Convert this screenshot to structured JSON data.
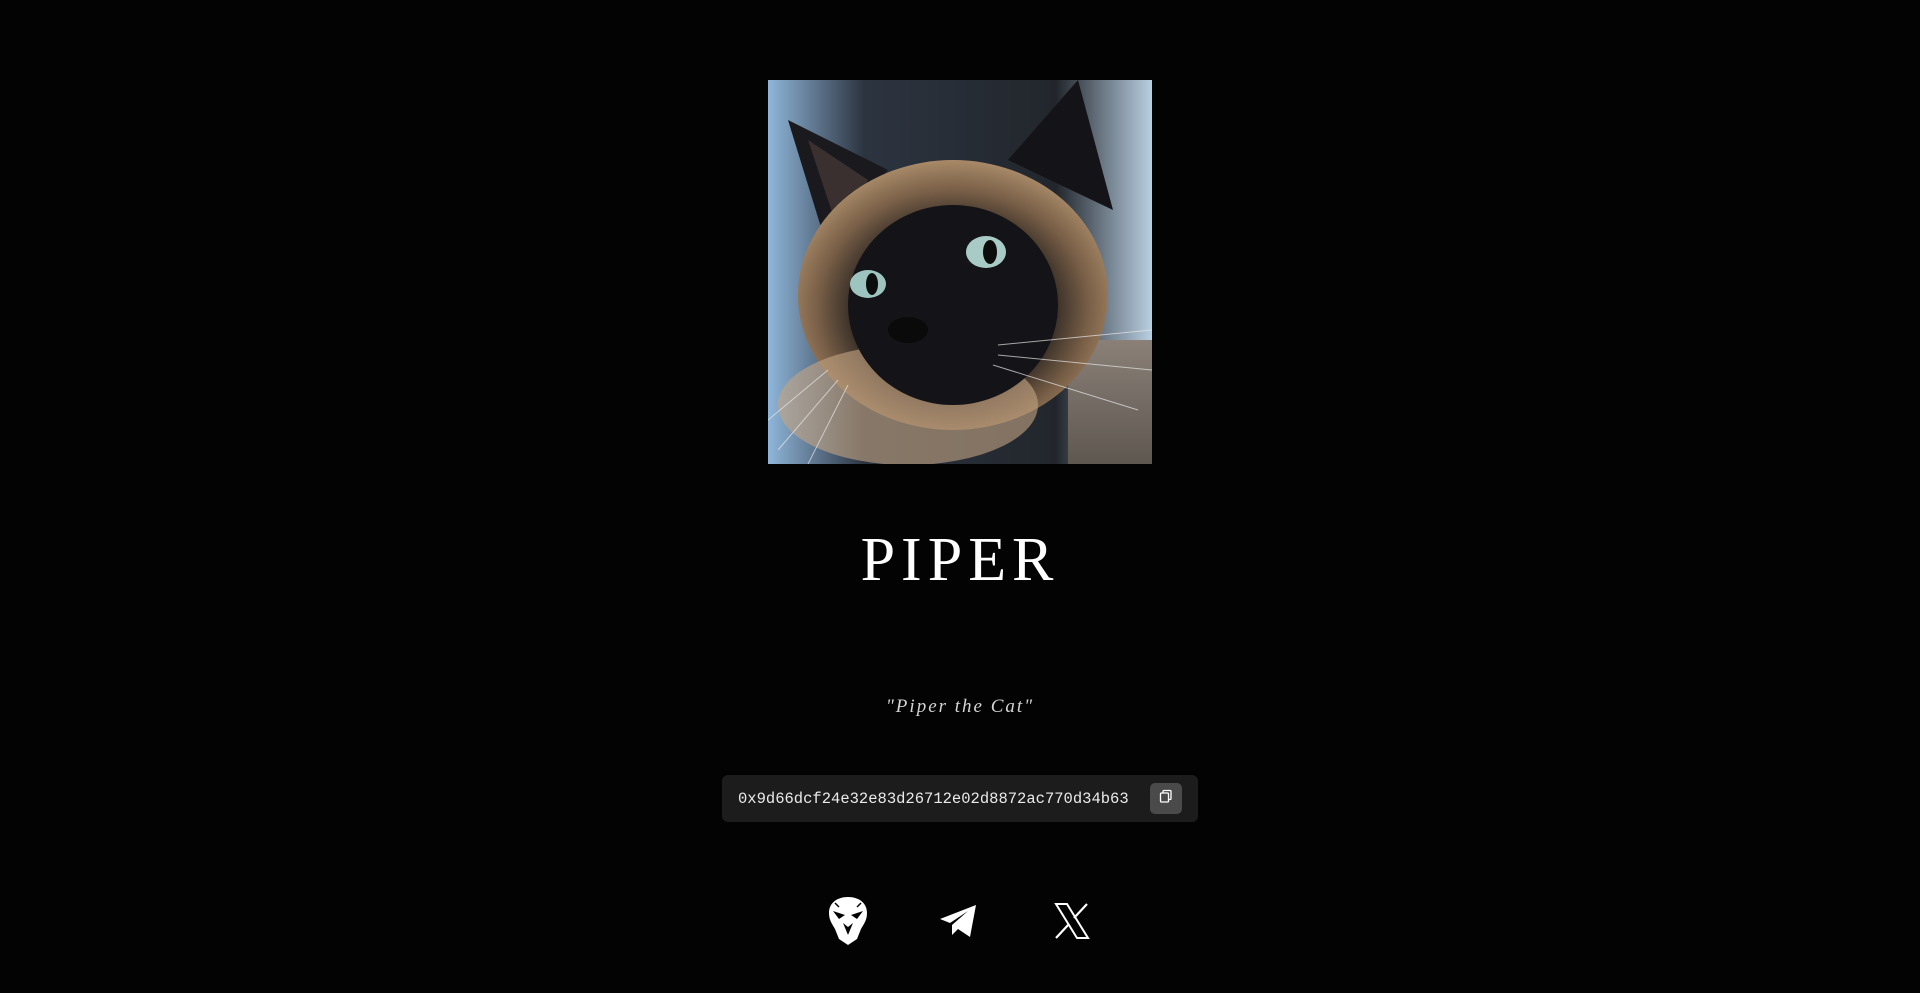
{
  "token": {
    "name": "PIPER",
    "tagline": "\"Piper the Cat\"",
    "contract_address": "0x9d66dcf24e32e83d26712e02d8872ac770d34b63"
  },
  "hero_image": {
    "subject": "Siamese cat photo"
  },
  "copy_button": {
    "icon": "copy-icon"
  },
  "socials": [
    {
      "icon": "eagle-icon"
    },
    {
      "icon": "telegram-icon"
    },
    {
      "icon": "x-icon"
    }
  ],
  "colors": {
    "background": "#030303",
    "text": "#ffffff",
    "contract_box": "#1c1c1c",
    "copy_button": "#4a4a4a"
  }
}
